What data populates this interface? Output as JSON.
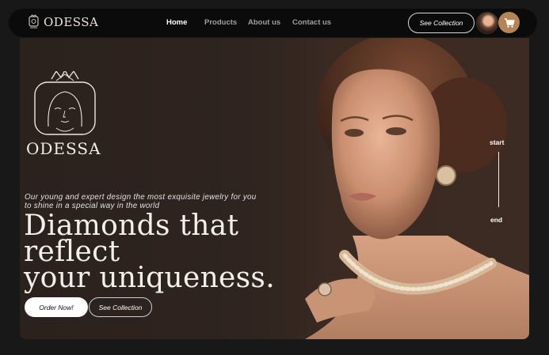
{
  "navbar": {
    "brand_name": "ODESSA",
    "links": [
      {
        "label": "Home",
        "active": true
      },
      {
        "label": "Products",
        "active": false
      },
      {
        "label": "About us",
        "active": false
      },
      {
        "label": "Contact us",
        "active": false
      }
    ],
    "see_collection_label": "See Collection",
    "cart_icon": "cart-icon",
    "accent_color": "#b48457"
  },
  "hero": {
    "logo_text": "ODESSA",
    "subtitle": "Our young and expert design the most exquisite jewelry for you to shine in a special way in the world",
    "headline_line1": "Diamonds that reflect",
    "headline_line2": "your uniqueness.",
    "order_button": "Order Now!",
    "see_button": "See Collection",
    "scroll_start": "start",
    "scroll_end": "end"
  }
}
